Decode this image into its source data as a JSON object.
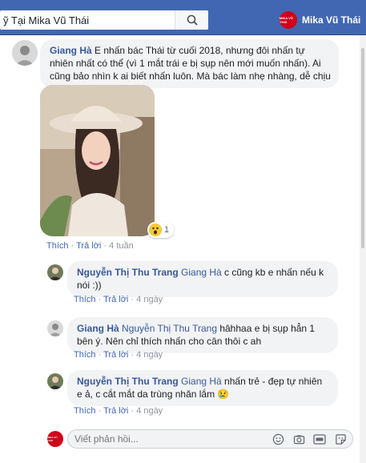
{
  "header": {
    "search_value": "ỹ Tại Mika Vũ Thái",
    "profile_name": "Mika Vũ Thái",
    "profile_logo_text": "MIKA VŨ THÁI"
  },
  "colors": {
    "topbar": "#4267b2",
    "link": "#385898",
    "bubble": "#f2f3f5",
    "meta": "#90949c",
    "brand": "#d0021b"
  },
  "main_comment": {
    "author": "Giang Hà",
    "text": " E nhấn bác Thái từ cuối 2018, nhưng đôi nhấn tự nhiên nhất có thể (vì 1 mắt trái e bị sụp nên mới muốn nhấn). Ai cũng bảo nhìn k ai biết nhấn luôn. Mà bác làm nhẹ nhàng, dễ chịu",
    "reaction_icon": "wow-emoji-icon",
    "reaction_count": "1",
    "like": "Thích",
    "separator": "·",
    "reply": "Trả lời",
    "time": "4 tuần"
  },
  "replies": [
    {
      "author": "Nguyễn Thị Thu Trang",
      "tag": "Giang Hà",
      "text": " c cũng kb e nhấn nếu k nói :))",
      "like": "Thích",
      "reply": "Trả lời",
      "time": "4 ngày"
    },
    {
      "author": "Giang Hà",
      "tag": "Nguyễn Thị Thu Trang",
      "text": " hâhhaa e bị sụp hẳn 1 bên ý. Nên chỉ thích nhấn cho cân thôi c ah",
      "like": "Thích",
      "reply": "Trả lời",
      "time": "4 ngày"
    },
    {
      "author": "Nguyễn Thị Thu Trang",
      "tag": "Giang Hà",
      "text": " nhấn trẻ - đẹp tự nhiên e ả, c cắt mắt da trùng nhăn lắm 😢",
      "like": "Thích",
      "reply": "Trả lời",
      "time": "4 ngày"
    }
  ],
  "reply_box": {
    "placeholder": "Viết phản hồi...",
    "icons": [
      "emoji-icon",
      "camera-icon",
      "gif-icon",
      "sticker-icon"
    ]
  }
}
